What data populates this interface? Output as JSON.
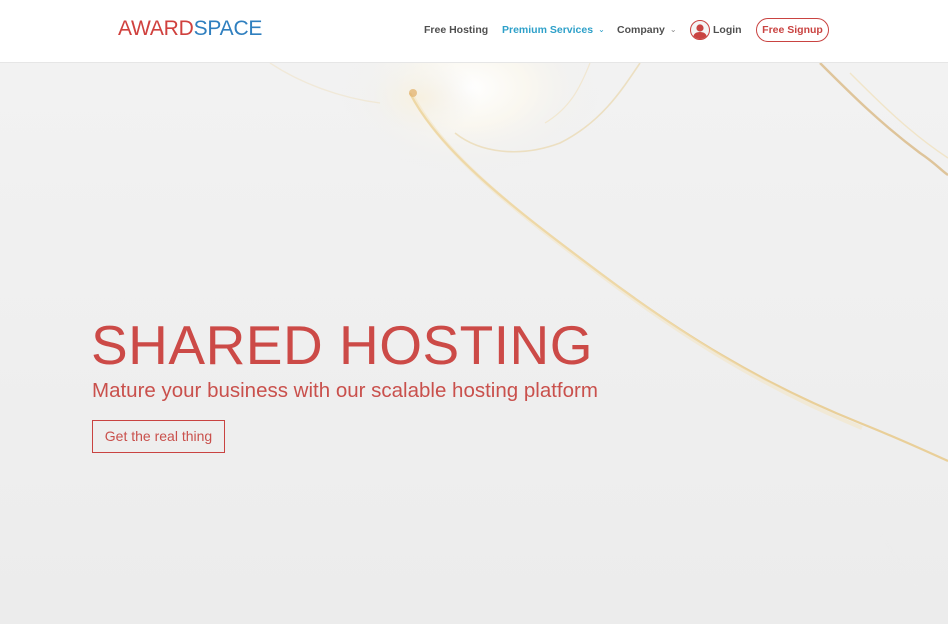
{
  "header": {
    "logo": {
      "part1": "AWARD",
      "part2": "SPACE"
    },
    "nav": {
      "free_hosting": "Free Hosting",
      "premium_services": "Premium Services",
      "company": "Company",
      "login": "Login",
      "signup": "Free Signup"
    },
    "icons": {
      "premium_chevron": "chevron-down-icon",
      "company_chevron": "chevron-down-icon",
      "login_avatar": "user-avatar-icon"
    }
  },
  "hero": {
    "title": "SHARED HOSTING",
    "subtitle": "Mature your business with our scalable hosting platform",
    "cta": "Get the real thing"
  },
  "colors": {
    "brand_red": "#cc4a47",
    "brand_blue": "#2f7fbf",
    "nav_active": "#2ea0c9",
    "nav_text": "#505050",
    "hero_bg": "#eeeeee"
  }
}
